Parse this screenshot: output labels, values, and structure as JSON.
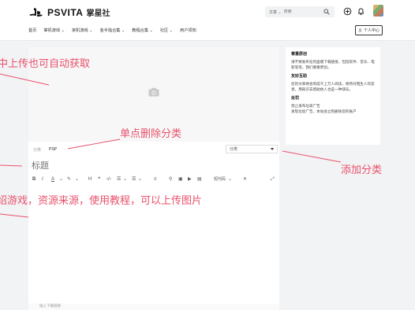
{
  "header": {
    "logo_text": "PSVITA",
    "logo_cn": "掌星社",
    "search_scope": "文章",
    "search_placeholder": "搜索",
    "user_center": "个人中心"
  },
  "nav": {
    "items": [
      "首页",
      "掌机游戏",
      "家机游戏",
      "金手指合集",
      "教程合集",
      "社区",
      "用户须知"
    ]
  },
  "editor": {
    "category_label": "分类",
    "category_tag": "PSP",
    "category_select": "分类",
    "title_placeholder": "标题",
    "toolbar": {
      "bold": "B",
      "italic": "I",
      "font_color": "A",
      "highlight": "✎",
      "heading": "H",
      "quote": "❝",
      "code": "‹/›",
      "ol": "☰",
      "ul": "☰",
      "align": "≡",
      "link": "⚲",
      "image": "▣",
      "video": "▶",
      "hr": "▤",
      "codeblock": "短代码",
      "clear": "✕",
      "fullscreen": "⤢"
    },
    "footer_text": "插入下载链接"
  },
  "sidebar": {
    "sections": [
      {
        "title": "尊重原创",
        "body": "请不要发布任何盗版下载链接，包括软件、音乐、电影等等，我们尊重原创。"
      },
      {
        "title": "友好互助",
        "body": "您的文章将会有成千上万人阅读，保持对陌生人的友善，用知识去帮助他人也是一种快乐。"
      },
      {
        "title": "处罚",
        "body": "禁止发布垃圾广告\n发现垃圾广告，本站会立刻删除您的账户"
      }
    ]
  },
  "annotations": {
    "cover_upload": "中上传也可自动获取",
    "delete_category": "单点删除分类",
    "add_category": "添加分类",
    "content_hint": "绍游戏，资源来源，使用教程，可以上传图片"
  },
  "colors": {
    "annotation": "#e8516b",
    "background": "#f2f3f5"
  }
}
